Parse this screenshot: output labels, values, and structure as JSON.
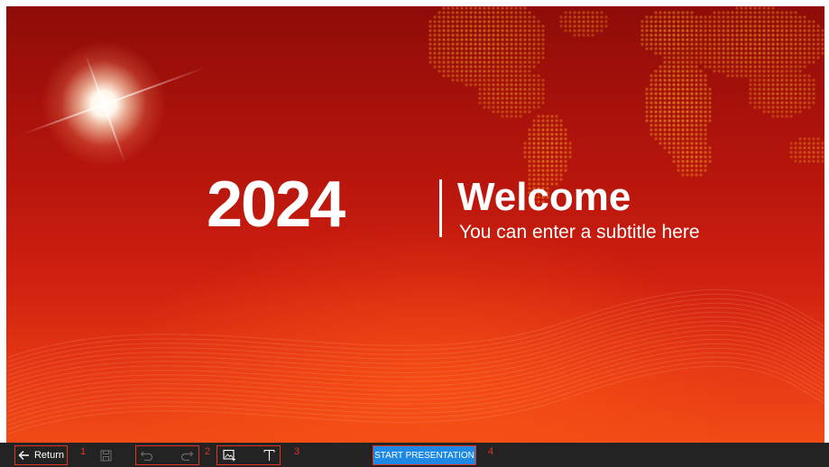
{
  "slide": {
    "year": "2024",
    "title": "Welcome",
    "subtitle": "You can enter a subtitle here"
  },
  "toolbar": {
    "return_label": "Return",
    "start_label": "START PRESENTATION",
    "markers": [
      "1",
      "2",
      "3",
      "4"
    ]
  },
  "icons": {
    "back": "arrow-left-icon",
    "save": "save-icon",
    "undo": "undo-icon",
    "redo": "redo-icon",
    "image": "insert-image-icon",
    "text": "text-icon"
  },
  "colors": {
    "slide_dark": "#8f0c08",
    "slide_light": "#f04a16",
    "map_dots": "#f5a020",
    "toolbar_bg": "#232323",
    "marker_red": "#e53224",
    "start_blue": "#1e88e5"
  }
}
